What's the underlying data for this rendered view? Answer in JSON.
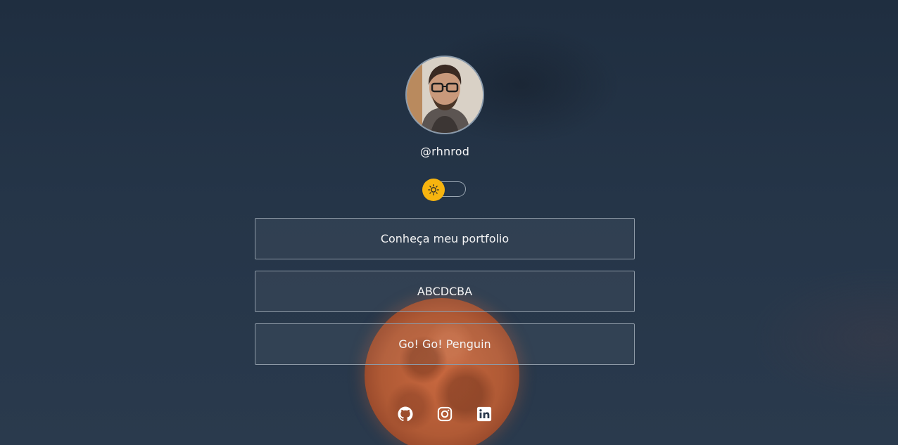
{
  "profile": {
    "handle": "@rhnrod",
    "avatar_alt": "profile photo"
  },
  "theme_toggle": {
    "icon": "sun-icon",
    "state": "light",
    "accent": "#f7b40f"
  },
  "links": [
    {
      "label": "Conheça meu portfolio"
    },
    {
      "label": "ABCDCBA"
    },
    {
      "label": "Go! Go! Penguin"
    }
  ],
  "socials": [
    {
      "icon": "github-icon"
    },
    {
      "icon": "instagram-icon"
    },
    {
      "icon": "linkedin-icon"
    }
  ],
  "colors": {
    "background": "#253548",
    "button_border": "#8d99a6",
    "text": "#f4f4f5"
  }
}
